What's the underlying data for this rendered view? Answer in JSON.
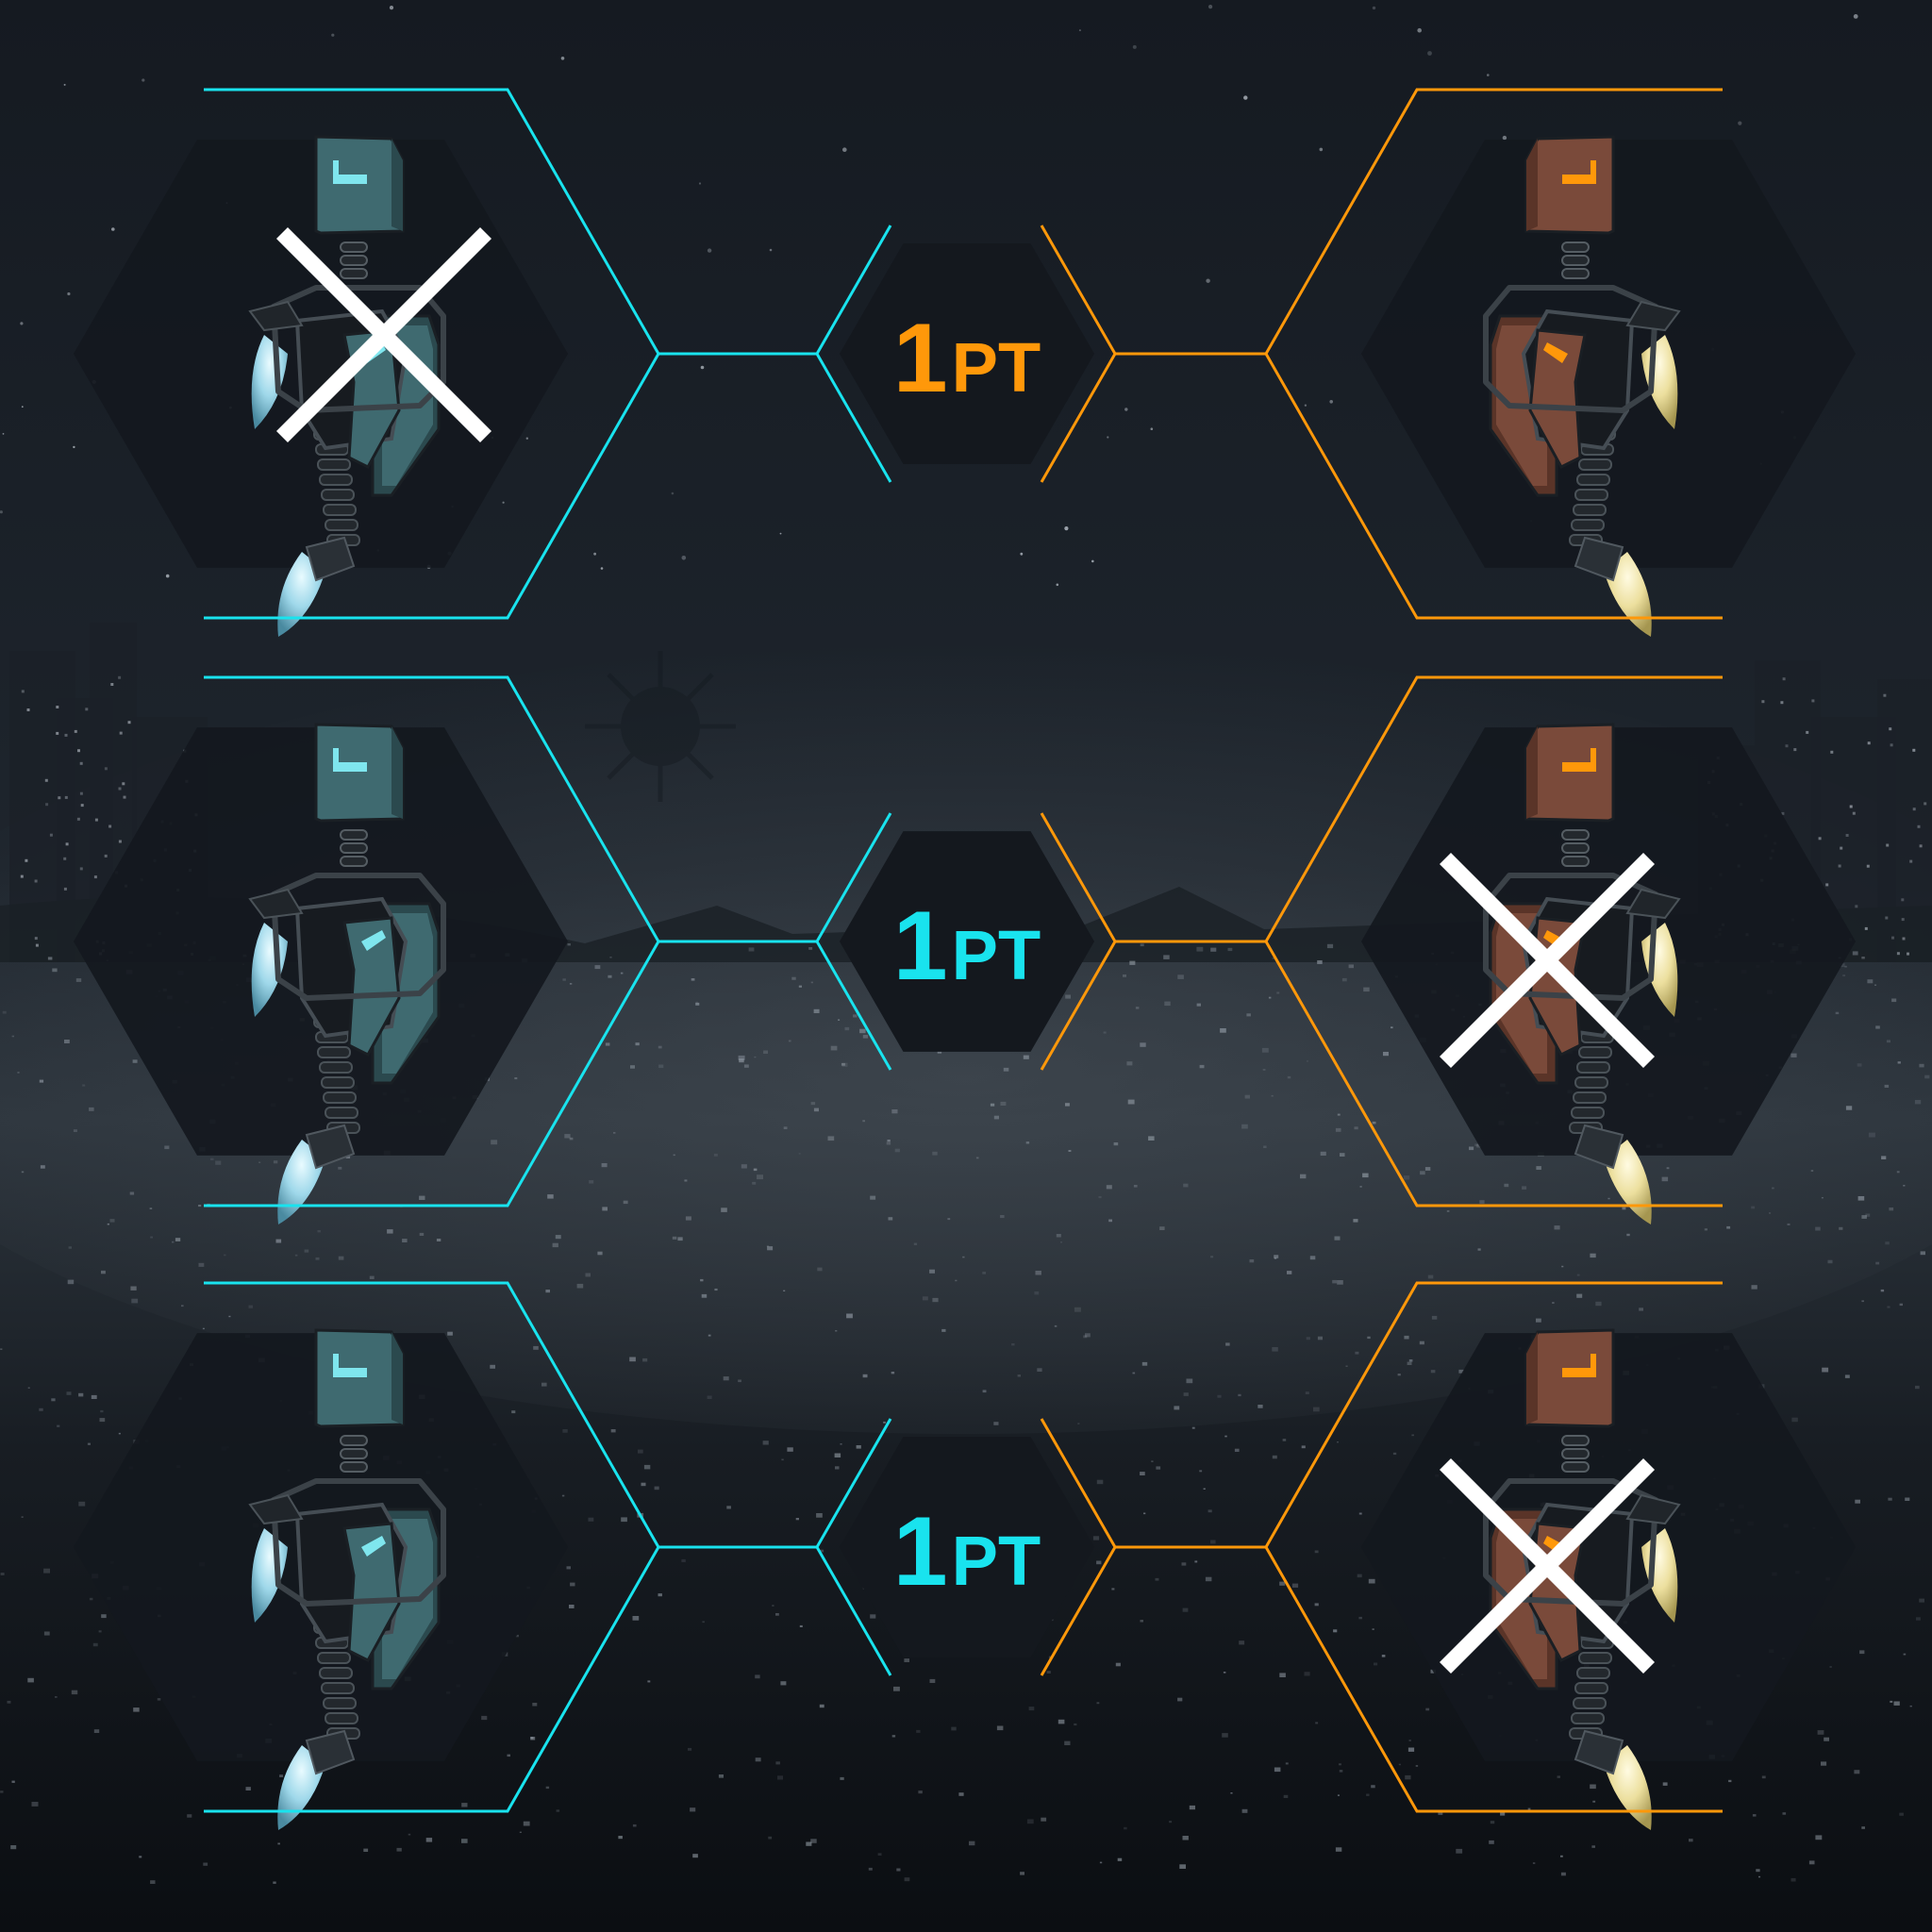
{
  "colors": {
    "blue_team": "#19e3ee",
    "orange_team": "#ff980a",
    "hex_fill": "#14181e",
    "cross": "#ffffff",
    "blue_robot_body": "#3f6a70",
    "orange_robot_body": "#7a4a3a"
  },
  "rounds": [
    {
      "points_number": "1",
      "points_unit": "PT",
      "winner": "orange",
      "blue_robot": {
        "icon": "blue-robot-icon",
        "eliminated": true
      },
      "orange_robot": {
        "icon": "orange-robot-icon",
        "eliminated": false
      }
    },
    {
      "points_number": "1",
      "points_unit": "PT",
      "winner": "blue",
      "blue_robot": {
        "icon": "blue-robot-icon",
        "eliminated": false
      },
      "orange_robot": {
        "icon": "orange-robot-icon",
        "eliminated": true
      }
    },
    {
      "points_number": "1",
      "points_unit": "PT",
      "winner": "blue",
      "blue_robot": {
        "icon": "blue-robot-icon",
        "eliminated": false
      },
      "orange_robot": {
        "icon": "orange-robot-icon",
        "eliminated": true
      }
    }
  ]
}
